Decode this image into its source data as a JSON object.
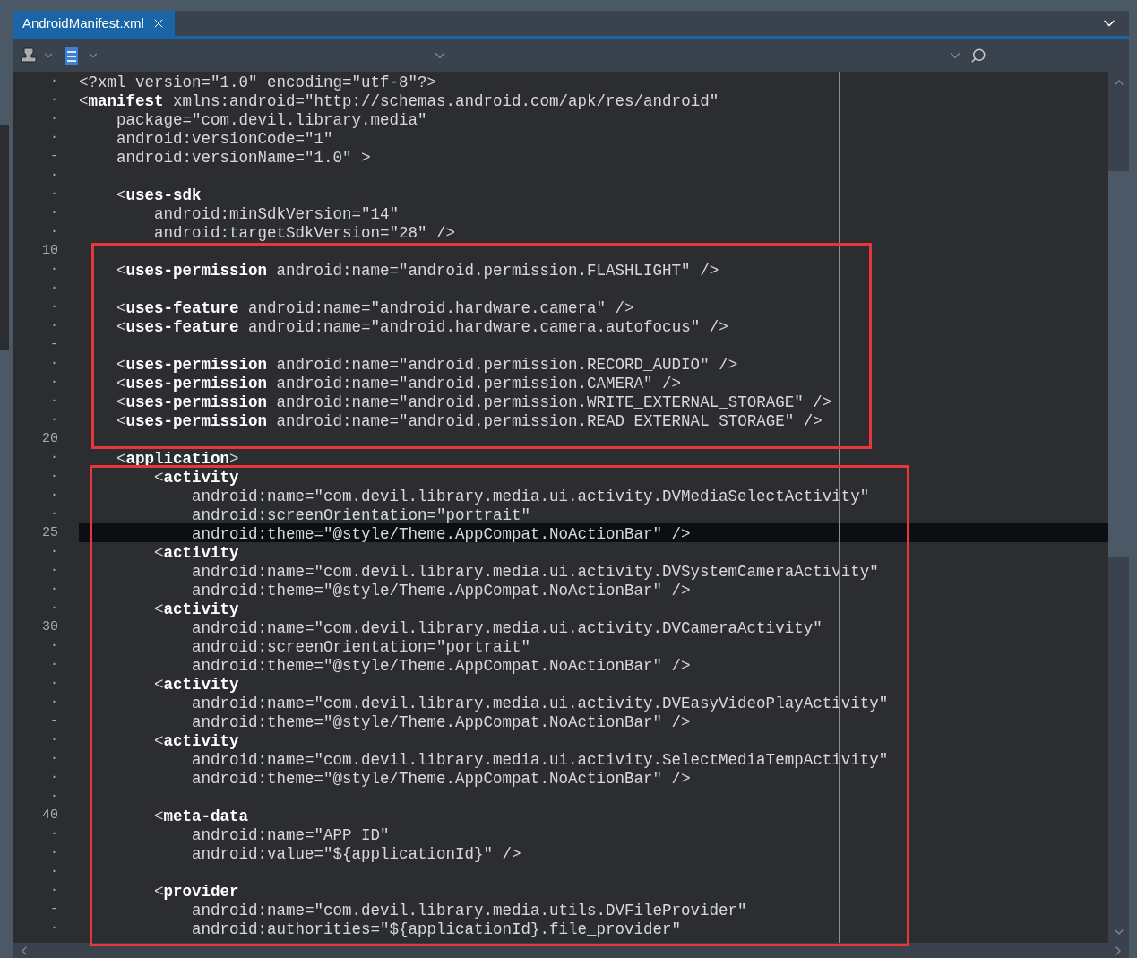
{
  "tab": {
    "title": "AndroidManifest.xml",
    "selected": true
  },
  "lines": [
    {
      "gutter": "·",
      "text": "<?xml version=\"1.0\" encoding=\"utf-8\"?>",
      "current": false
    },
    {
      "gutter": "·",
      "text": "<**manifest** xmlns:android=\"http://schemas.android.com/apk/res/android\"",
      "current": false
    },
    {
      "gutter": "·",
      "text": "    package=\"com.devil.library.media\"",
      "current": false
    },
    {
      "gutter": "·",
      "text": "    android:versionCode=\"1\"",
      "current": false
    },
    {
      "gutter": "-",
      "text": "    android:versionName=\"1.0\" >",
      "current": false
    },
    {
      "gutter": "·",
      "current": false
    },
    {
      "gutter": "·",
      "text": "    <**uses-sdk**",
      "current": false
    },
    {
      "gutter": "·",
      "text": "        android:minSdkVersion=\"14\"",
      "current": false
    },
    {
      "gutter": "·",
      "text": "        android:targetSdkVersion=\"28\" />",
      "current": false
    },
    {
      "gutter": "10",
      "current": false
    },
    {
      "gutter": "·",
      "text": "    <**uses-permission** android:name=\"android.permission.FLASHLIGHT\" />",
      "current": false
    },
    {
      "gutter": "·",
      "current": false
    },
    {
      "gutter": "·",
      "text": "    <**uses-feature** android:name=\"android.hardware.camera\" />",
      "current": false
    },
    {
      "gutter": "·",
      "text": "    <**uses-feature** android:name=\"android.hardware.camera.autofocus\" />",
      "current": false
    },
    {
      "gutter": "-",
      "current": false
    },
    {
      "gutter": "·",
      "text": "    <**uses-permission** android:name=\"android.permission.RECORD_AUDIO\" />",
      "current": false
    },
    {
      "gutter": "·",
      "text": "    <**uses-permission** android:name=\"android.permission.CAMERA\" />",
      "current": false
    },
    {
      "gutter": "·",
      "text": "    <**uses-permission** android:name=\"android.permission.WRITE_EXTERNAL_STORAGE\" />",
      "current": false
    },
    {
      "gutter": "·",
      "text": "    <**uses-permission** android:name=\"android.permission.READ_EXTERNAL_STORAGE\" />",
      "current": false
    },
    {
      "gutter": "20",
      "current": false
    },
    {
      "gutter": "·",
      "text": "    <**application**>",
      "current": false
    },
    {
      "gutter": "·",
      "text": "        <**activity**",
      "current": false
    },
    {
      "gutter": "·",
      "text": "            android:name=\"com.devil.library.media.ui.activity.DVMediaSelectActivity\"",
      "current": false
    },
    {
      "gutter": "·",
      "text": "            android:screenOrientation=\"portrait\"",
      "current": false
    },
    {
      "gutter": "25",
      "text": "            android:theme=\"@style/Theme.AppCompat.NoActionBar\" />",
      "current": true
    },
    {
      "gutter": "·",
      "text": "        <**activity**",
      "current": false
    },
    {
      "gutter": "·",
      "text": "            android:name=\"com.devil.library.media.ui.activity.DVSystemCameraActivity\"",
      "current": false
    },
    {
      "gutter": "·",
      "text": "            android:theme=\"@style/Theme.AppCompat.NoActionBar\" />",
      "current": false
    },
    {
      "gutter": "·",
      "text": "        <**activity**",
      "current": false
    },
    {
      "gutter": "30",
      "text": "            android:name=\"com.devil.library.media.ui.activity.DVCameraActivity\"",
      "current": false
    },
    {
      "gutter": "·",
      "text": "            android:screenOrientation=\"portrait\"",
      "current": false
    },
    {
      "gutter": "·",
      "text": "            android:theme=\"@style/Theme.AppCompat.NoActionBar\" />",
      "current": false
    },
    {
      "gutter": "·",
      "text": "        <**activity**",
      "current": false
    },
    {
      "gutter": "·",
      "text": "            android:name=\"com.devil.library.media.ui.activity.DVEasyVideoPlayActivity\"",
      "current": false
    },
    {
      "gutter": "-",
      "text": "            android:theme=\"@style/Theme.AppCompat.NoActionBar\" />",
      "current": false
    },
    {
      "gutter": "·",
      "text": "        <**activity**",
      "current": false
    },
    {
      "gutter": "·",
      "text": "            android:name=\"com.devil.library.media.ui.activity.SelectMediaTempActivity\"",
      "current": false
    },
    {
      "gutter": "·",
      "text": "            android:theme=\"@style/Theme.AppCompat.NoActionBar\" />",
      "current": false
    },
    {
      "gutter": "·",
      "current": false
    },
    {
      "gutter": "40",
      "text": "        <**meta-data**",
      "current": false
    },
    {
      "gutter": "·",
      "text": "            android:name=\"APP_ID\"",
      "current": false
    },
    {
      "gutter": "·",
      "text": "            android:value=\"${applicationId}\" />",
      "current": false
    },
    {
      "gutter": "·",
      "current": false
    },
    {
      "gutter": "·",
      "text": "        <**provider**",
      "current": false
    },
    {
      "gutter": "-",
      "text": "            android:name=\"com.devil.library.media.utils.DVFileProvider\"",
      "current": false
    },
    {
      "gutter": "·",
      "text": "            android:authorities=\"${applicationId}.file_provider\"",
      "current": false
    }
  ]
}
